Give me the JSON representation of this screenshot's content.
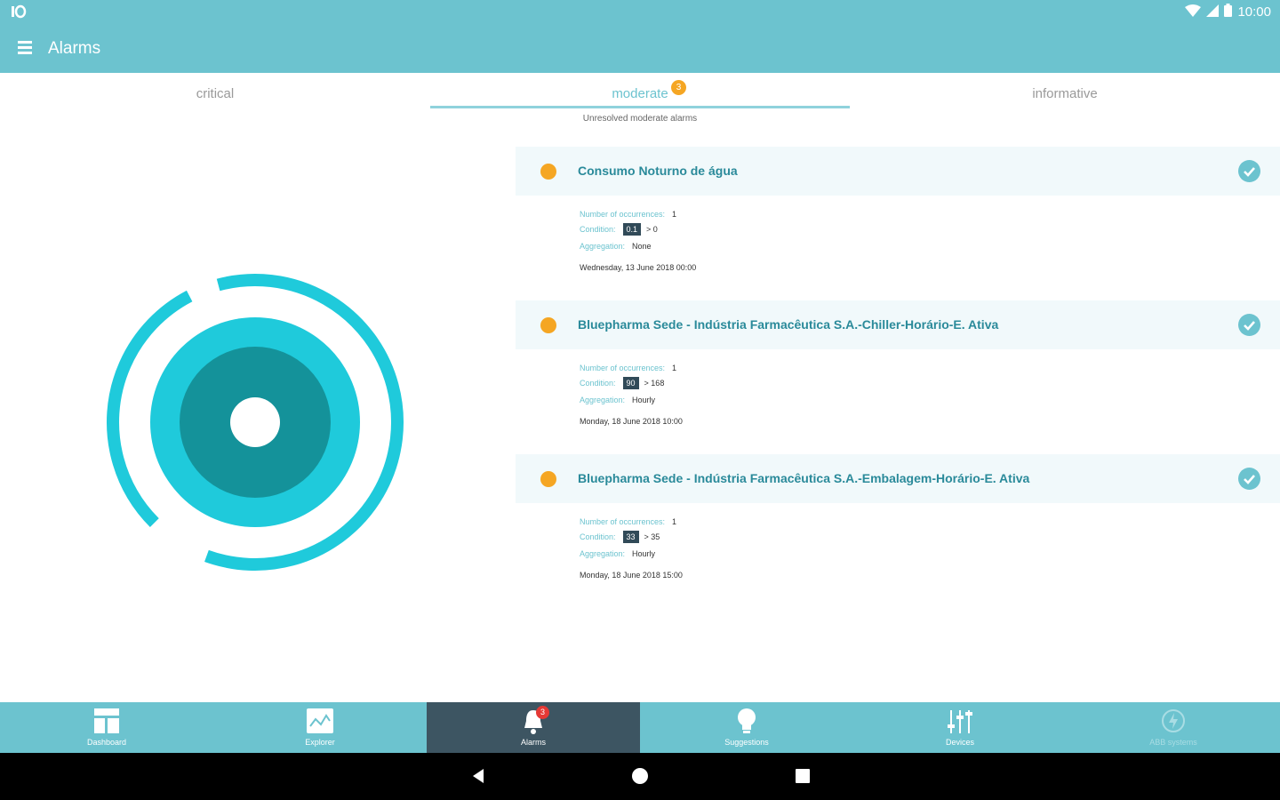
{
  "status": {
    "left_icon": "notification-icon",
    "time": "10:00"
  },
  "appbar": {
    "title": "Alarms"
  },
  "tabs": [
    {
      "label": "critical"
    },
    {
      "label": "moderate",
      "badge": "3"
    },
    {
      "label": "informative"
    }
  ],
  "subtitle": "Unresolved moderate alarms",
  "labels": {
    "occurrences": "Number of occurrences:",
    "condition": "Condition:",
    "aggregation": "Aggregation:"
  },
  "alarms": [
    {
      "name": "Consumo Noturno de água",
      "occurrences": "1",
      "condition_value": "0.1",
      "condition_op": "> 0",
      "aggregation": "None",
      "date": "Wednesday, 13 June 2018 00:00"
    },
    {
      "name": "Bluepharma Sede - Indústria Farmacêutica S.A.-Chiller-Horário-E. Ativa",
      "occurrences": "1",
      "condition_value": "90",
      "condition_op": "> 168",
      "aggregation": "Hourly",
      "date": "Monday, 18 June 2018 10:00"
    },
    {
      "name": "Bluepharma Sede - Indústria Farmacêutica S.A.-Embalagem-Horário-E. Ativa",
      "occurrences": "1",
      "condition_value": "33",
      "condition_op": "> 35",
      "aggregation": "Hourly",
      "date": "Monday, 18 June 2018 15:00"
    }
  ],
  "bottom_nav": [
    {
      "label": "Dashboard",
      "icon": "dashboard-icon"
    },
    {
      "label": "Explorer",
      "icon": "explorer-icon"
    },
    {
      "label": "Alarms",
      "icon": "bell-icon",
      "badge": "3"
    },
    {
      "label": "Suggestions",
      "icon": "lightbulb-icon"
    },
    {
      "label": "Devices",
      "icon": "sliders-icon"
    },
    {
      "label": "ABB systems",
      "icon": "power-icon"
    }
  ],
  "colors": {
    "primary": "#6cc3cf",
    "accent": "#f5a623",
    "active_nav": "#3d5562",
    "logo_ring": "#1fcadb",
    "logo_core": "#14929a"
  }
}
